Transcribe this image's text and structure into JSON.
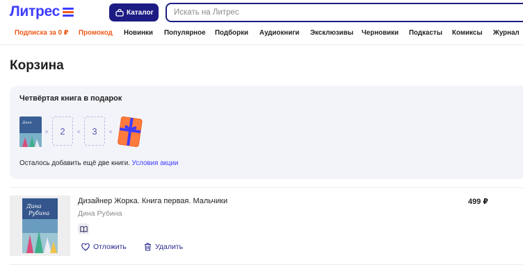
{
  "header": {
    "logo_text": "Литрес",
    "catalog_label": "Каталог",
    "search_placeholder": "Искать на Литрес"
  },
  "nav": [
    {
      "label": "Подписка за 0 ₽",
      "highlight": true
    },
    {
      "label": "Промокод",
      "highlight": true
    },
    {
      "label": "Новинки",
      "highlight": false
    },
    {
      "label": "Популярное",
      "highlight": false
    },
    {
      "label": "Подборки",
      "highlight": false
    },
    {
      "label": "Аудиокниги",
      "highlight": false
    },
    {
      "label": "Эксклюзивы",
      "highlight": false
    },
    {
      "label": "Черновики",
      "highlight": false
    },
    {
      "label": "Подкасты",
      "highlight": false
    },
    {
      "label": "Комиксы",
      "highlight": false
    },
    {
      "label": "Журнал",
      "highlight": false
    }
  ],
  "page": {
    "title": "Корзина"
  },
  "promo": {
    "title": "Четвёртая книга в подарок",
    "slots": [
      "2",
      "3"
    ],
    "note": "Осталось добавить ещё две книги.",
    "link": "Условия акции"
  },
  "cart_item": {
    "title": "Дизайнер Жорка. Книга первая. Мальчики",
    "author": "Дина Рубина",
    "price": "499 ₽",
    "postpone_label": "Отложить",
    "delete_label": "Удалить"
  },
  "colors": {
    "brand": "#3d3bff",
    "catalog_button": "#1c1c84",
    "nav_highlight": "#f05a1a",
    "promo_bg": "#f3f4fa",
    "gift_box": "#ff7a3d",
    "gift_ribbon": "#3d3bff"
  },
  "icons": {
    "catalog": "bag-icon",
    "gift": "gift-box-icon",
    "item_type": "book-icon",
    "postpone": "heart-icon",
    "delete": "trash-icon"
  }
}
